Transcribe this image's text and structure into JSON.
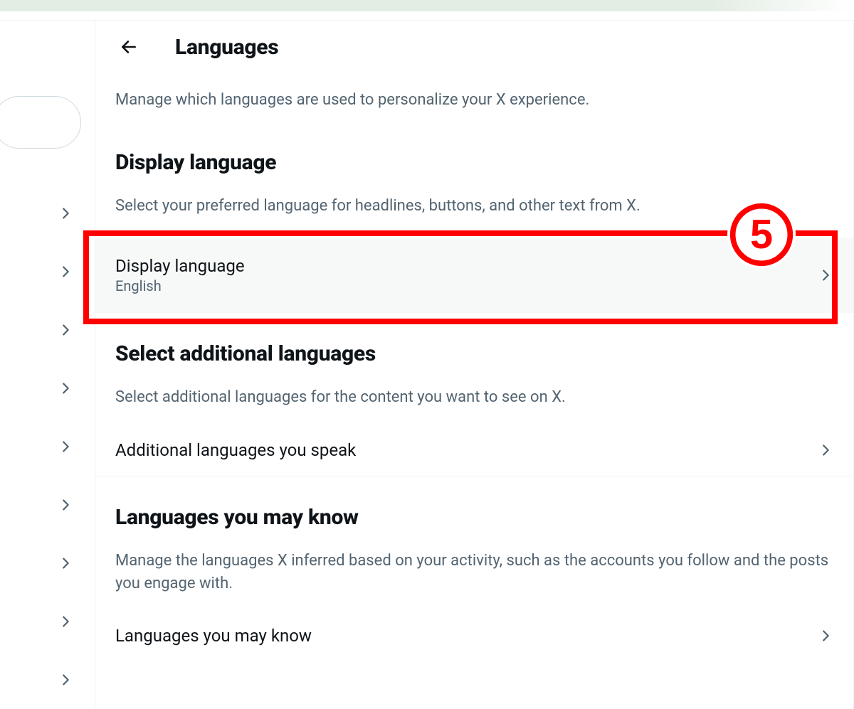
{
  "header": {
    "title": "Languages"
  },
  "intro": "Manage which languages are used to personalize your X experience.",
  "sections": {
    "display": {
      "title": "Display language",
      "desc": "Select your preferred language for headlines, buttons, and other text from X.",
      "row_title": "Display language",
      "row_value": "English"
    },
    "additional": {
      "title": "Select additional languages",
      "desc": "Select additional languages for the content you want to see on X.",
      "row_title": "Additional languages you speak"
    },
    "known": {
      "title": "Languages you may know",
      "desc": "Manage the languages X inferred based on your activity, such as the accounts you follow and the posts you engage with.",
      "row_title": "Languages you may know"
    }
  },
  "annotation": {
    "number": "5"
  }
}
